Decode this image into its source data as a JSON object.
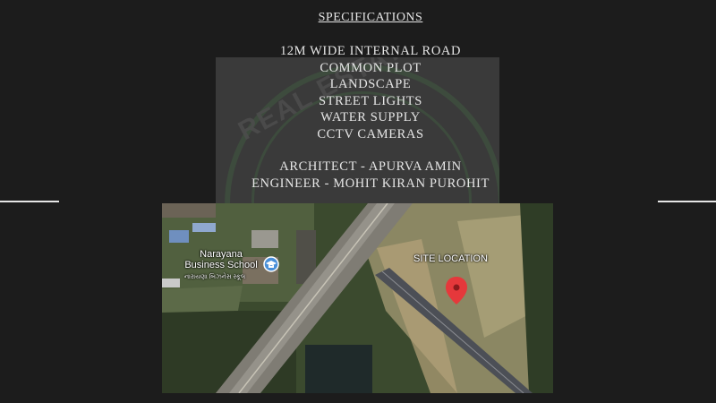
{
  "specifications": {
    "title": "SPECIFICATIONS",
    "items": [
      "12M WIDE INTERNAL ROAD",
      "COMMON PLOT",
      "LANDSCAPE",
      "STREET LIGHTS",
      "WATER SUPPLY",
      "CCTV CAMERAS"
    ]
  },
  "credits": {
    "architect": "ARCHITECT - APURVA AMIN",
    "engineer": "ENGINEER - MOHIT KIRAN PUROHIT"
  },
  "watermark": {
    "text": "REAL ESTATE REGULATORY AU"
  },
  "map": {
    "place_name": "Narayana\nBusiness School",
    "place_name_local": "નારાયણા બિઝનેસ સ્કૂલ",
    "place_icon": "graduation-cap-icon",
    "site_label": "SITE LOCATION",
    "marker_icon": "map-pin-icon",
    "marker_color": "#e5383b"
  },
  "colors": {
    "background": "#1c1c1c",
    "text": "#e6e6e6",
    "watermark_box": "#3a3a3a"
  }
}
